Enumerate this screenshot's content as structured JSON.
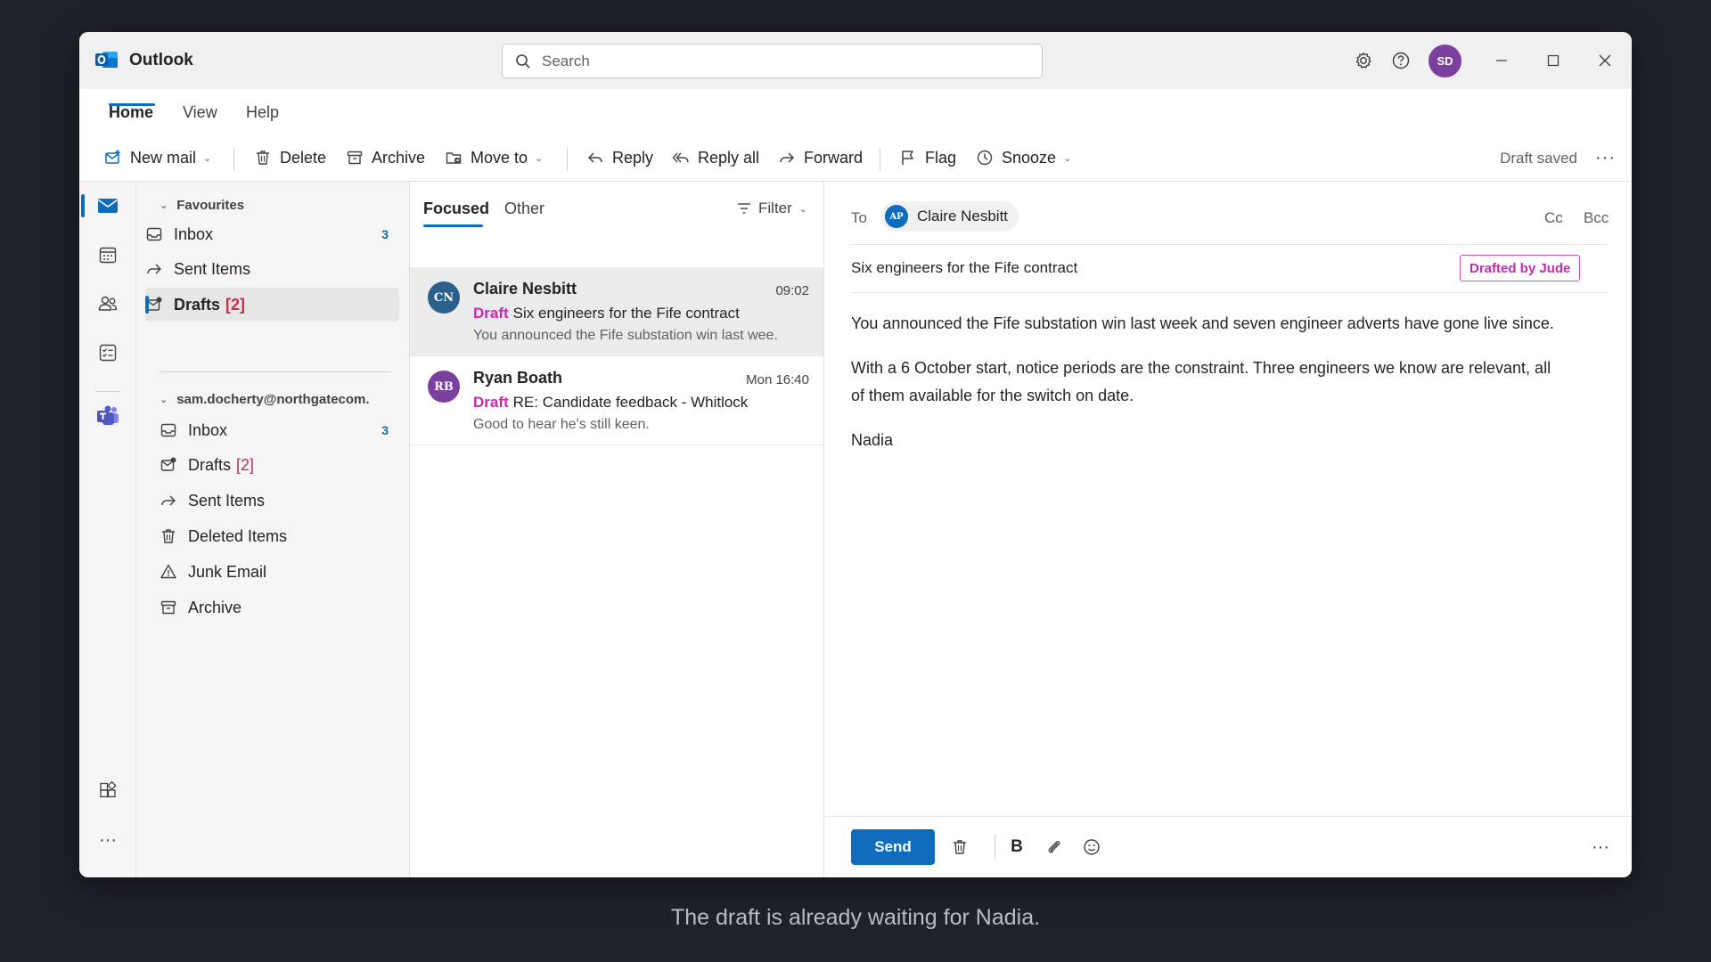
{
  "window": {
    "app_name": "Outlook",
    "search_placeholder": "Search",
    "avatar_initials": "SD"
  },
  "ribbon": {
    "tabs": [
      "Home",
      "View",
      "Help"
    ],
    "active_tab": "Home"
  },
  "toolbar": {
    "new_mail": "New mail",
    "delete": "Delete",
    "archive": "Archive",
    "move_to": "Move to",
    "reply": "Reply",
    "reply_all": "Reply all",
    "forward": "Forward",
    "flag": "Flag",
    "snooze": "Snooze",
    "status": "Draft saved"
  },
  "folders": {
    "favourites_label": "Favourites",
    "favourites": [
      {
        "label": "Inbox",
        "count": "3",
        "icon": "inbox-icon"
      },
      {
        "label": "Sent Items",
        "count": "",
        "icon": "sent-icon"
      },
      {
        "label": "Drafts",
        "badge": "[2]",
        "icon": "drafts-icon",
        "selected": true
      }
    ],
    "account_label": "sam.docherty@northgatecom.",
    "account": [
      {
        "label": "Inbox",
        "count": "3",
        "icon": "inbox-icon"
      },
      {
        "label": "Drafts",
        "badge": "[2]",
        "icon": "drafts-icon"
      },
      {
        "label": "Sent Items",
        "icon": "sent-icon"
      },
      {
        "label": "Deleted Items",
        "icon": "trash-icon"
      },
      {
        "label": "Junk Email",
        "icon": "junk-icon"
      },
      {
        "label": "Archive",
        "icon": "archive-icon"
      }
    ]
  },
  "message_list": {
    "tabs": [
      "Focused",
      "Other"
    ],
    "filter_label": "Filter",
    "messages": [
      {
        "initials": "CN",
        "avatar_color": "#2b5f8c",
        "sender": "Claire Nesbitt",
        "time": "09:02",
        "draft_label": "Draft",
        "subject": "Six engineers for the Fife contract",
        "preview": "You announced the Fife substation win last wee.",
        "selected": true
      },
      {
        "initials": "RB",
        "avatar_color": "#7b3f9e",
        "sender": "Ryan Boath",
        "time": "Mon 16:40",
        "draft_label": "Draft",
        "subject": "RE: Candidate feedback - Whitlock",
        "preview": "Good to hear he's still keen."
      }
    ]
  },
  "reading_pane": {
    "to_label": "To",
    "recipient_initials": "AP",
    "recipient_name": "Claire Nesbitt",
    "cc_label": "Cc",
    "bcc_label": "Bcc",
    "subject": "Six engineers for the Fife contract",
    "badge": "Drafted by Jude",
    "body": [
      "You announced the Fife substation win last week and seven engineer adverts have gone live since.",
      "With a 6 October start, notice periods are the constraint. Three engineers we know are relevant, all of them available for the switch on date.",
      "Nadia"
    ],
    "send_label": "Send"
  },
  "caption": "The draft is already waiting for Nadia.",
  "colors": {
    "accent": "#0f6cbd",
    "draft": "#c42bad",
    "badge": "#c4314b"
  }
}
